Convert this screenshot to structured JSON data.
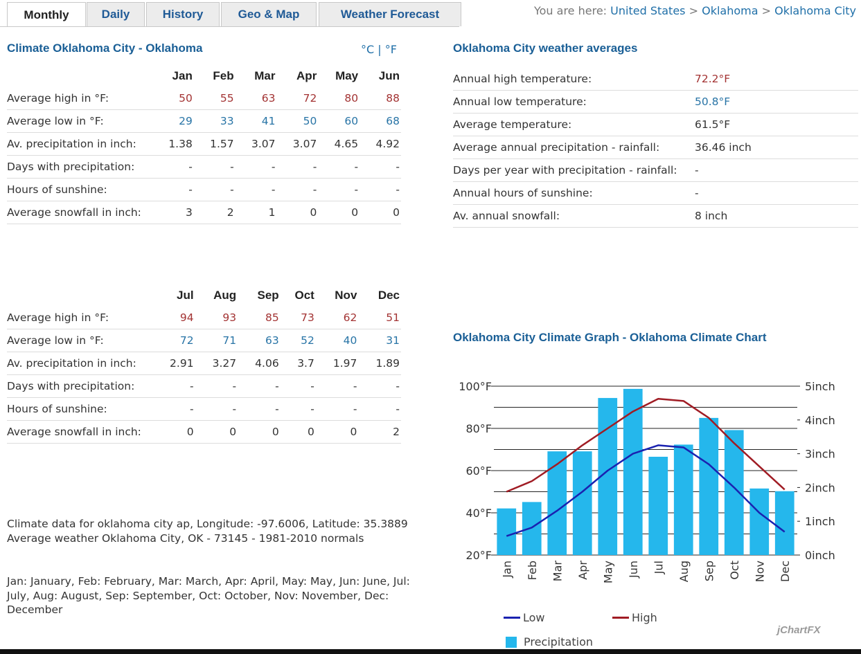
{
  "tabs": [
    {
      "label": "Monthly",
      "active": true
    },
    {
      "label": "Daily"
    },
    {
      "label": "History"
    },
    {
      "label": "Geo & Map"
    },
    {
      "label": "Weather Forecast"
    }
  ],
  "breadcrumb": {
    "prefix": "You are here:",
    "items": [
      "United States",
      "Oklahoma",
      "Oklahoma City"
    ],
    "separator": ">"
  },
  "climate": {
    "title": "Climate Oklahoma City - Oklahoma",
    "unit_c": "°C",
    "unit_sep": "|",
    "unit_f": "°F",
    "row_labels": {
      "high": "Average high in °F:",
      "low": "Average low in °F:",
      "precip": "Av. precipitation in inch:",
      "days": "Days with precipitation:",
      "sun": "Hours of sunshine:",
      "snow": "Average snowfall in inch:"
    },
    "half1": {
      "months": [
        "Jan",
        "Feb",
        "Mar",
        "Apr",
        "May",
        "Jun"
      ],
      "high": [
        "50",
        "55",
        "63",
        "72",
        "80",
        "88"
      ],
      "low": [
        "29",
        "33",
        "41",
        "50",
        "60",
        "68"
      ],
      "precip": [
        "1.38",
        "1.57",
        "3.07",
        "3.07",
        "4.65",
        "4.92"
      ],
      "days": [
        "-",
        "-",
        "-",
        "-",
        "-",
        "-"
      ],
      "sun": [
        "-",
        "-",
        "-",
        "-",
        "-",
        "-"
      ],
      "snow": [
        "3",
        "2",
        "1",
        "0",
        "0",
        "0"
      ]
    },
    "half2": {
      "months": [
        "Jul",
        "Aug",
        "Sep",
        "Oct",
        "Nov",
        "Dec"
      ],
      "high": [
        "94",
        "93",
        "85",
        "73",
        "62",
        "51"
      ],
      "low": [
        "72",
        "71",
        "63",
        "52",
        "40",
        "31"
      ],
      "precip": [
        "2.91",
        "3.27",
        "4.06",
        "3.7",
        "1.97",
        "1.89"
      ],
      "days": [
        "-",
        "-",
        "-",
        "-",
        "-",
        "-"
      ],
      "sun": [
        "-",
        "-",
        "-",
        "-",
        "-",
        "-"
      ],
      "snow": [
        "0",
        "0",
        "0",
        "0",
        "0",
        "2"
      ]
    },
    "note1": "Climate data for oklahoma city ap, Longitude: -97.6006, Latitude: 35.3889",
    "note2": "Average weather Oklahoma City, OK - 73145 - 1981-2010 normals",
    "note3": "Jan: January, Feb: February, Mar: March, Apr: April, May: May, Jun: June, Jul: July, Aug: August, Sep: September, Oct: October, Nov: November, Dec: December"
  },
  "averages": {
    "title": "Oklahoma City weather averages",
    "rows": [
      {
        "label": "Annual high temperature:",
        "value": "72.2°F",
        "color": "#a33333"
      },
      {
        "label": "Annual low temperature:",
        "value": "50.8°F",
        "color": "#2874a6"
      },
      {
        "label": "Average temperature:",
        "value": "61.5°F"
      },
      {
        "label": "Average annual precipitation - rainfall:",
        "value": "36.46 inch"
      },
      {
        "label": "Days per year with precipitation - rainfall:",
        "value": "-"
      },
      {
        "label": "Annual hours of sunshine:",
        "value": "-"
      },
      {
        "label": "Av. annual snowfall:",
        "value": "8 inch"
      }
    ]
  },
  "graph": {
    "title": "Oklahoma City Climate Graph - Oklahoma Climate Chart",
    "brand": "jChartFX"
  },
  "colors": {
    "high": "#a01c24",
    "low": "#1a22b0",
    "precip": "#25b7ec",
    "link": "#1f6fa8"
  },
  "chart_data": {
    "type": "bar",
    "categories": [
      "Jan",
      "Feb",
      "Mar",
      "Apr",
      "May",
      "Jun",
      "Jul",
      "Aug",
      "Sep",
      "Oct",
      "Nov",
      "Dec"
    ],
    "series": [
      {
        "name": "Precipitation",
        "type": "bar",
        "axis": "right",
        "values": [
          1.38,
          1.57,
          3.07,
          3.07,
          4.65,
          4.92,
          2.91,
          3.27,
          4.06,
          3.7,
          1.97,
          1.89
        ]
      },
      {
        "name": "High",
        "type": "line",
        "axis": "left",
        "values": [
          50,
          55,
          63,
          72,
          80,
          88,
          94,
          93,
          85,
          73,
          62,
          51
        ]
      },
      {
        "name": "Low",
        "type": "line",
        "axis": "left",
        "values": [
          29,
          33,
          41,
          50,
          60,
          68,
          72,
          71,
          63,
          52,
          40,
          31
        ]
      }
    ],
    "y_left": {
      "ticks": [
        "100°F",
        "80°F",
        "60°F",
        "40°F",
        "20°F"
      ],
      "range": [
        20,
        100
      ]
    },
    "y_right": {
      "ticks": [
        "5inch",
        "4inch",
        "3inch",
        "2inch",
        "1inch",
        "0inch"
      ],
      "range": [
        0,
        5
      ]
    },
    "legend": [
      "Low",
      "High",
      "Precipitation"
    ],
    "legend_position": "bottom",
    "grid": true
  }
}
